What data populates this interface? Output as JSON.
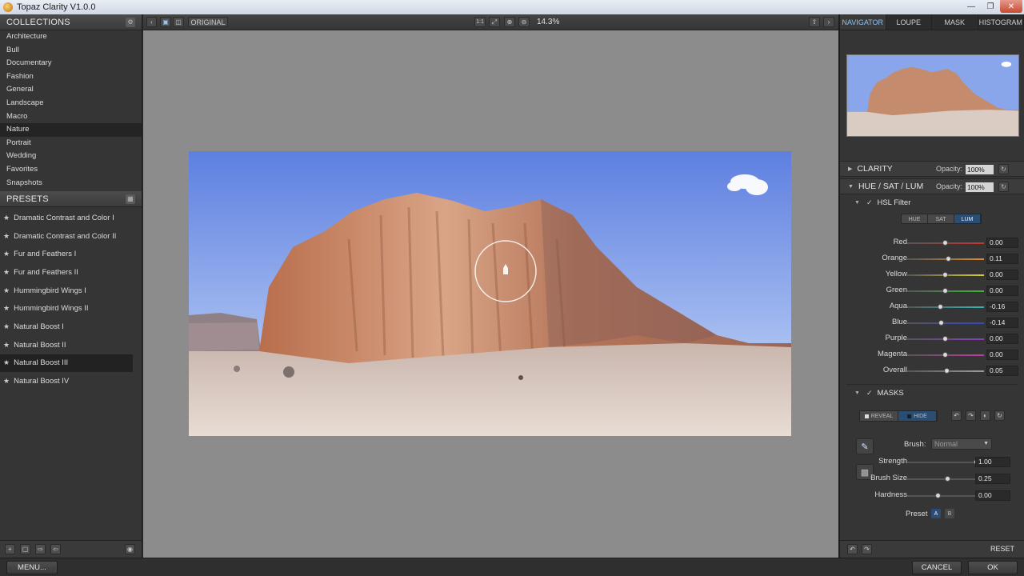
{
  "window": {
    "title": "Topaz Clarity V1.0.0",
    "min": "—",
    "max": "❐",
    "close": "✕"
  },
  "collections": {
    "header": "COLLECTIONS",
    "items": [
      "Architecture",
      "Bull",
      "Documentary",
      "Fashion",
      "General",
      "Landscape",
      "Macro",
      "Nature",
      "Portrait",
      "Wedding",
      "Favorites",
      "Snapshots"
    ],
    "selected": "Nature"
  },
  "presets": {
    "header": "PRESETS",
    "items": [
      "Dramatic Contrast and Color I",
      "Dramatic Contrast and Color II",
      "Fur and Feathers I",
      "Fur and Feathers II",
      "Hummingbird Wings I",
      "Hummingbird Wings II",
      "Natural Boost I",
      "Natural Boost II",
      "Natural Boost III",
      "Natural Boost IV"
    ],
    "selected": "Natural Boost III"
  },
  "toolbar": {
    "original_label": "ORIGINAL",
    "ratio_label": "1:1",
    "zoom": "14.3%"
  },
  "tabs": [
    {
      "label": "NAVIGATOR",
      "active": true
    },
    {
      "label": "LOUPE"
    },
    {
      "label": "MASK"
    },
    {
      "label": "HISTOGRAM"
    }
  ],
  "clarity": {
    "label": "CLARITY",
    "opacity_label": "Opacity:",
    "opacity": "100%"
  },
  "hsl_panel": {
    "label": "HUE / SAT / LUM",
    "opacity_label": "Opacity:",
    "opacity": "100%"
  },
  "hsl_filter": {
    "label": "HSL Filter",
    "modes": [
      "HUE",
      "SAT",
      "LUM"
    ],
    "active_mode": "LUM",
    "sliders": [
      {
        "label": "Red",
        "value": "0.00",
        "color": "#c8342c"
      },
      {
        "label": "Orange",
        "value": "0.11",
        "color": "#e08a2a"
      },
      {
        "label": "Yellow",
        "value": "0.00",
        "color": "#d8cf2a"
      },
      {
        "label": "Green",
        "value": "0.00",
        "color": "#3fb43a"
      },
      {
        "label": "Aqua",
        "value": "-0.16",
        "color": "#35b6b8"
      },
      {
        "label": "Blue",
        "value": "-0.14",
        "color": "#3546c8"
      },
      {
        "label": "Purple",
        "value": "0.00",
        "color": "#8a3cc0"
      },
      {
        "label": "Magenta",
        "value": "0.00",
        "color": "#c03aa8"
      },
      {
        "label": "Overall",
        "value": "0.05",
        "color": "#9a9a9a"
      }
    ]
  },
  "masks": {
    "label": "MASKS",
    "reveal_label": "REVEAL",
    "hide_label": "HIDE",
    "brush_label": "Brush:",
    "brush_mode": "Normal",
    "strength_label": "Strength",
    "strength": "1.00",
    "brush_size_label": "Brush Size",
    "brush_size": "0.25",
    "hardness_label": "Hardness",
    "hardness": "0.00",
    "preset_label": "Preset",
    "preset_a": "A",
    "preset_b": "B"
  },
  "footer": {
    "menu_label": "MENU...",
    "cancel_label": "CANCEL",
    "ok_label": "OK",
    "reset_label": "RESET"
  }
}
